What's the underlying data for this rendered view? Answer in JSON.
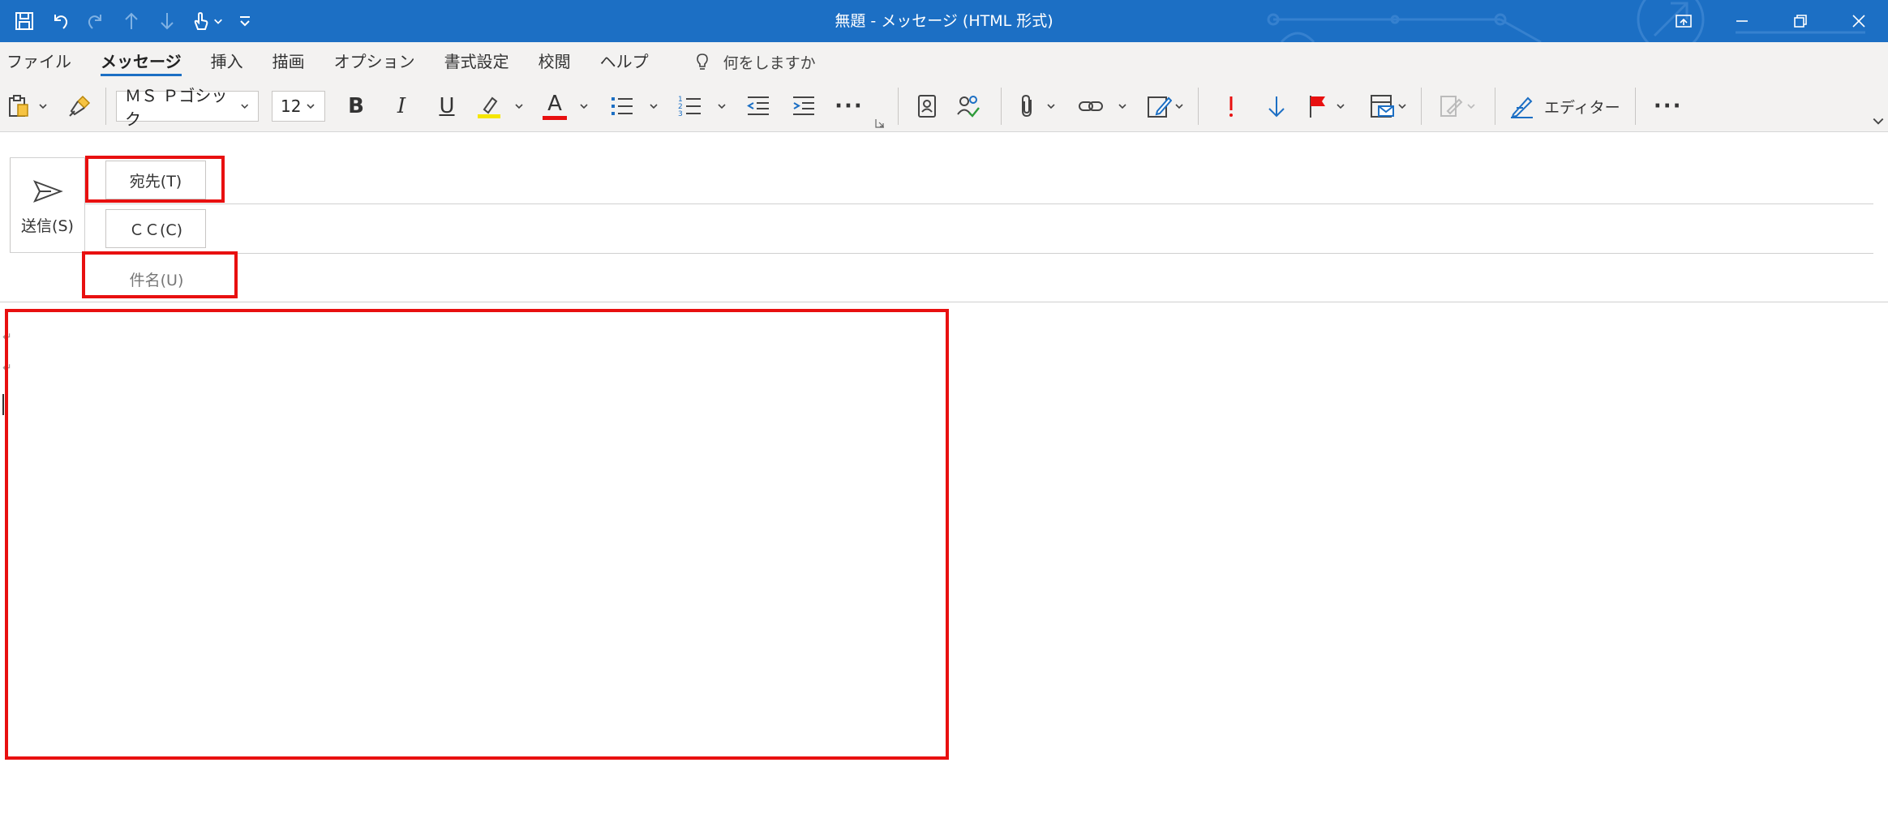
{
  "window": {
    "title": "無題  -  メッセージ (HTML 形式)",
    "title_bar_color": "#1c6fc4",
    "quick_access": [
      "save-icon",
      "undo-icon",
      "redo-icon",
      "previous-item-icon",
      "next-item-icon",
      "touch-mode-icon",
      "customize-qat-icon"
    ],
    "controls": [
      "ribbon-display-options-icon",
      "minimize-icon",
      "restore-icon",
      "close-icon"
    ]
  },
  "tabs": {
    "items": [
      {
        "label": "ファイル",
        "active": false
      },
      {
        "label": "メッセージ",
        "active": true
      },
      {
        "label": "挿入",
        "active": false
      },
      {
        "label": "描画",
        "active": false
      },
      {
        "label": "オプション",
        "active": false
      },
      {
        "label": "書式設定",
        "active": false
      },
      {
        "label": "校閲",
        "active": false
      },
      {
        "label": "ヘルプ",
        "active": false
      }
    ],
    "tell_me": "何をしますか"
  },
  "ribbon": {
    "font_name": "ＭＳ Ｐゴシック",
    "font_size": "12",
    "bold": "B",
    "italic": "I",
    "underline": "U",
    "font_color_letter": "A",
    "highlight_color": "#f5e600",
    "font_color": "#e81010",
    "more": "···",
    "editor_label": "エディター"
  },
  "compose": {
    "send_label": "送信(S)",
    "to_label": "宛先(T)",
    "cc_label": "ＣＣ(C)",
    "subject_label": "件名(U)",
    "highlight_color": "#e81010"
  }
}
